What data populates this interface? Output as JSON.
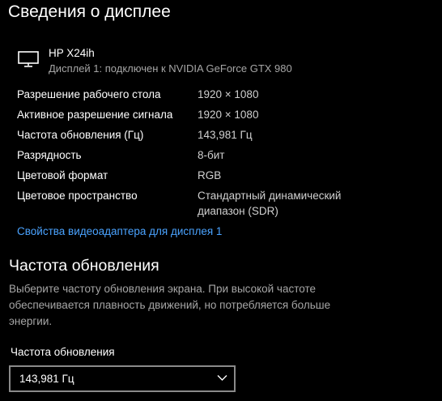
{
  "page_title": "Сведения о дисплее",
  "monitor": {
    "icon": "monitor-icon",
    "name": "HP X24ih",
    "description": "Дисплей 1: подключен к NVIDIA GeForce GTX 980"
  },
  "info_rows": [
    {
      "label": "Разрешение рабочего стола",
      "value": "1920 × 1080"
    },
    {
      "label": "Активное разрешение сигнала",
      "value": "1920 × 1080"
    },
    {
      "label": "Частота обновления (Гц)",
      "value": "143,981 Гц"
    },
    {
      "label": "Разрядность",
      "value": "8-бит"
    },
    {
      "label": "Цветовой формат",
      "value": "RGB"
    },
    {
      "label": "Цветовое пространство",
      "value": "Стандартный динамический диапазон (SDR)"
    }
  ],
  "adapter_link": "Свойства видеоадаптера для дисплея 1",
  "refresh_section": {
    "title": "Частота обновления",
    "description": "Выберите частоту обновления экрана. При высокой частоте обеспечивается плавность движений, но потребляется больше энергии.",
    "field_label": "Частота обновления",
    "selected_value": "143,981 Гц",
    "dropdown_icon": "chevron-down-icon"
  },
  "colors": {
    "background": "#000000",
    "text": "#ffffff",
    "secondary_text": "#a6a6a6",
    "link": "#4aa3ff",
    "border": "#8a8a8a"
  }
}
